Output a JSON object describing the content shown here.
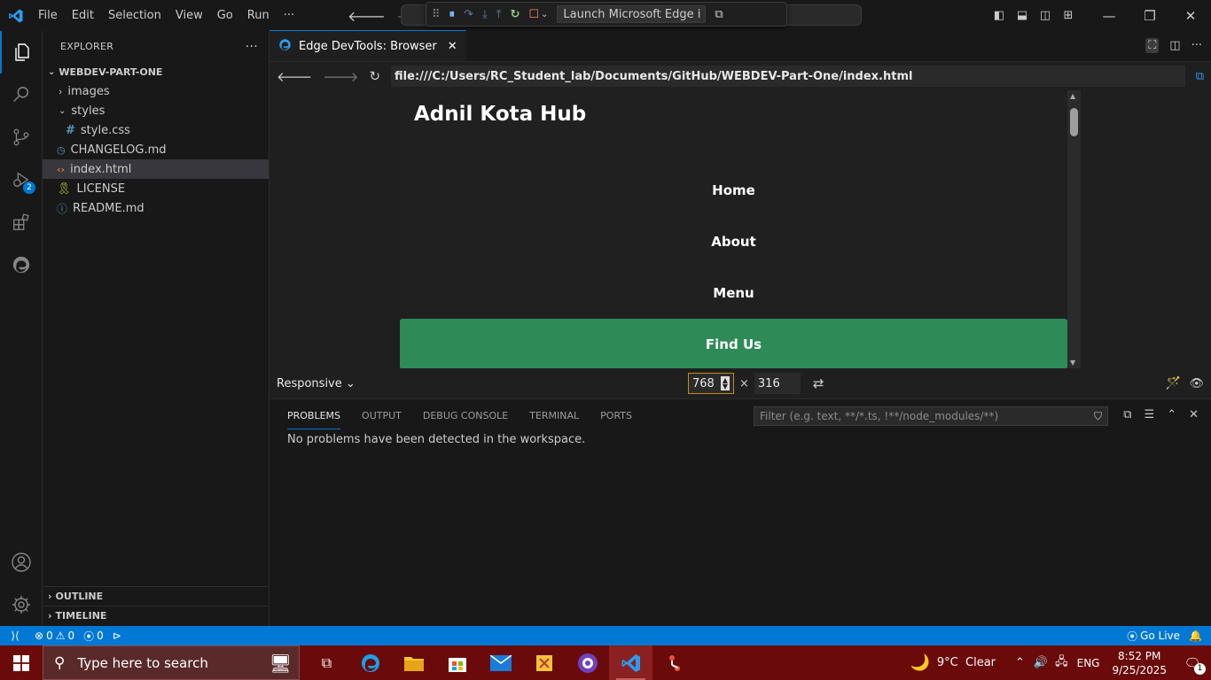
{
  "titlebar": {
    "menu": [
      "File",
      "Edit",
      "Selection",
      "View",
      "Go",
      "Run",
      "···"
    ],
    "debug_config": "Launch Microsoft Edge i"
  },
  "activity": {
    "debug_badge": "2"
  },
  "explorer": {
    "header": "EXPLORER",
    "more": "···",
    "root": "WEBDEV-PART-ONE",
    "items": [
      {
        "label": "images",
        "type": "folder-closed"
      },
      {
        "label": "styles",
        "type": "folder-open"
      },
      {
        "label": "style.css",
        "type": "css"
      },
      {
        "label": "CHANGELOG.md",
        "type": "changelog"
      },
      {
        "label": "index.html",
        "type": "html"
      },
      {
        "label": "LICENSE",
        "type": "license"
      },
      {
        "label": "README.md",
        "type": "readme"
      }
    ],
    "outline": "OUTLINE",
    "timeline": "TIMELINE"
  },
  "editor": {
    "tab_label": "Edge DevTools: Browser",
    "url": "file:///C:/Users/RC_Student_lab/Documents/GitHub/WEBDEV-Part-One/index.html"
  },
  "webpage": {
    "title": "Adnil Kota Hub",
    "nav": [
      "Home",
      "About",
      "Menu",
      "Find Us"
    ],
    "highlight_color": "#2e8b57"
  },
  "device": {
    "mode": "Responsive",
    "width": "768",
    "times": "×",
    "height": "316"
  },
  "panel": {
    "tabs": [
      "PROBLEMS",
      "OUTPUT",
      "DEBUG CONSOLE",
      "TERMINAL",
      "PORTS"
    ],
    "filter_placeholder": "Filter (e.g. text, **/*.ts, !**/node_modules/**)",
    "message": "No problems have been detected in the workspace."
  },
  "status": {
    "errors": "0",
    "warnings": "0",
    "ports": "0",
    "go_live": "Go Live"
  },
  "taskbar": {
    "search_placeholder": "Type here to search",
    "weather": "9°C  Clear",
    "lang": "ENG",
    "time": "8:52 PM",
    "date": "9/25/2025",
    "notif": "1"
  },
  "colors": {
    "accent": "#0078d4",
    "taskbar": "#6b0a0a"
  }
}
